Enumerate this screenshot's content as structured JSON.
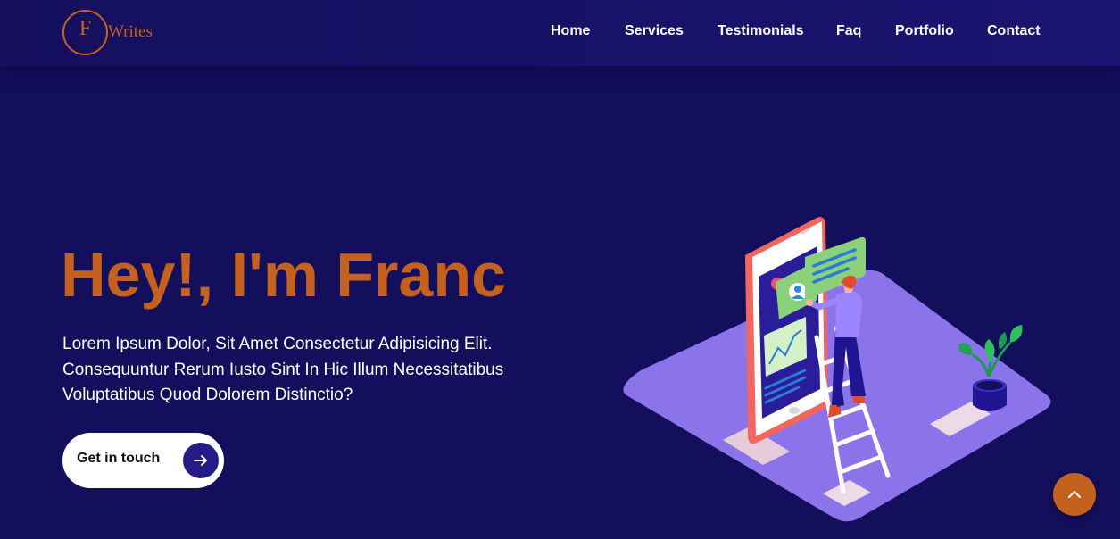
{
  "header": {
    "logo": {
      "letter": "F",
      "word": "Writes"
    },
    "nav": [
      {
        "label": "Home"
      },
      {
        "label": "Services"
      },
      {
        "label": "Testimonials"
      },
      {
        "label": "Faq"
      },
      {
        "label": "Portfolio"
      },
      {
        "label": "Contact"
      }
    ]
  },
  "hero": {
    "title": "Hey!, I'm Franc",
    "text": "Lorem Ipsum Dolor, Sit Amet Consectetur Adipisicing Elit. Consequuntur Rerum Iusto Sint In Hic Illum Necessitatibus Voluptatibus Quod Dolorem Distinctio?",
    "cta_label": "Get in touch"
  },
  "icons": {
    "cta": "arrow-right-icon",
    "scroll": "chevron-up-icon"
  },
  "colors": {
    "background": "#140f5c",
    "accent": "#c4611f",
    "cta_circle": "#241b86",
    "platform": "#8b73ea"
  }
}
